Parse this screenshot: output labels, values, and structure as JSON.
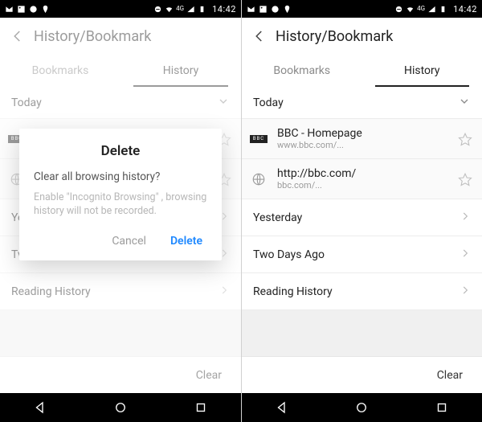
{
  "status": {
    "clock": "14:42",
    "network_label": "4G"
  },
  "toolbar": {
    "title": "History/Bookmark"
  },
  "tabs": {
    "bookmarks": "Bookmarks",
    "history": "History"
  },
  "sections": {
    "today": "Today",
    "yesterday": "Yesterday",
    "two_days_ago": "Two Days Ago",
    "reading_history": "Reading History"
  },
  "history": {
    "items": [
      {
        "title": "BBC - Homepage",
        "subtitle": "www.bbc.com/..."
      },
      {
        "title": "http://bbc.com/",
        "subtitle": "bbc.com/..."
      }
    ]
  },
  "left_truncated": {
    "yesterday_short": "Ye",
    "twodays_short": "Tv"
  },
  "footer": {
    "clear": "Clear"
  },
  "dialog": {
    "title": "Delete",
    "message": "Clear all browsing history?",
    "hint": "Enable \"Incognito Browsing\" , browsing history will not be recorded.",
    "cancel": "Cancel",
    "confirm": "Delete"
  }
}
